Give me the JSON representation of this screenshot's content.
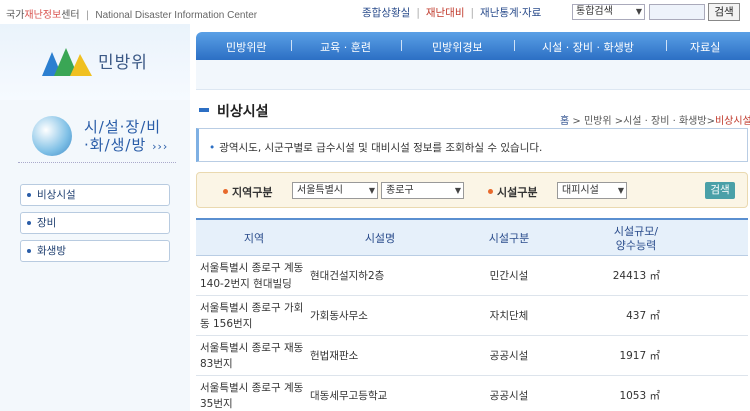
{
  "header": {
    "site_name_pre": "국가",
    "site_name_accent": "재난정보",
    "site_name_post": "센터",
    "site_name_sep": "|",
    "site_name_en": "National Disaster Information Center",
    "links": [
      {
        "label": "종합상황실"
      },
      {
        "label": "재난대비"
      },
      {
        "label": "재난통계·자료"
      }
    ],
    "link_sep": "|",
    "search_select": "통합검색",
    "search_button": "검색"
  },
  "sidebar": {
    "logo_text": "민방위",
    "banner_line1": "시/설·장/비",
    "banner_line2": "·화/생/방",
    "banner_arrows": "›››",
    "menu": [
      {
        "label": "비상시설"
      },
      {
        "label": "장비"
      },
      {
        "label": "화생방"
      }
    ]
  },
  "nav": {
    "items": [
      "민방위란",
      "교육 · 훈련",
      "민방위경보",
      "시설 · 장비 · 화생방",
      "자료실"
    ]
  },
  "page": {
    "title": "비상시설",
    "breadcrumb_home": "홈",
    "breadcrumb_mid": " > 민방위 >시설 · 장비 · 화생방>",
    "breadcrumb_current": "비상시설",
    "info": "광역시도, 시군구별로 급수시설 및 대비시설 정보를 조회하실 수 있습니다."
  },
  "filter": {
    "region_label": "지역구분",
    "region1": "서울특별시",
    "region2": "종로구",
    "facility_label": "시설구분",
    "facility_value": "대피시설",
    "search_button": "검색"
  },
  "table": {
    "headers": [
      "지역",
      "시설명",
      "시설구분",
      "시설규모/\n양수능력"
    ],
    "rows": [
      {
        "region": "서울특별시 종로구 계동 140-2번지 현대빌딩",
        "name": "현대건설지하2층",
        "type": "민간시설",
        "size": "24413 ㎡"
      },
      {
        "region": "서울특별시 종로구 가회동 156번지",
        "name": "가회동사무소",
        "type": "자치단체",
        "size": "437 ㎡"
      },
      {
        "region": "서울특별시 종로구 재동 83번지",
        "name": "헌법재판소",
        "type": "공공시설",
        "size": "1917 ㎡"
      },
      {
        "region": "서울특별시 종로구 계동 35번지",
        "name": "대동세무고등학교",
        "type": "공공시설",
        "size": "1053 ㎡"
      }
    ]
  }
}
